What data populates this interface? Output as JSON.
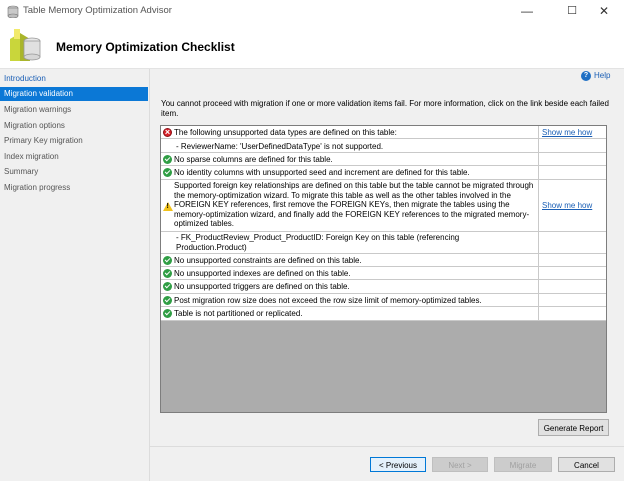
{
  "window": {
    "title": "Table Memory Optimization Advisor",
    "controls": {
      "minimize": "—",
      "maximize": "☐",
      "close": "✕"
    }
  },
  "header": {
    "title": "Memory Optimization Checklist",
    "icon": "memory-optimization-icon"
  },
  "sidebar": {
    "items": [
      {
        "label": "Introduction",
        "state": "link"
      },
      {
        "label": "Migration validation",
        "state": "active"
      },
      {
        "label": "Migration warnings",
        "state": "normal"
      },
      {
        "label": "Migration options",
        "state": "normal"
      },
      {
        "label": "Primary Key migration",
        "state": "normal"
      },
      {
        "label": "Index migration",
        "state": "normal"
      },
      {
        "label": "Summary",
        "state": "normal"
      },
      {
        "label": "Migration progress",
        "state": "normal"
      }
    ]
  },
  "main": {
    "help_label": "Help",
    "intro": "You cannot proceed with migration if one or more validation items fail. For more information, click on the link beside each failed item.",
    "checklist": [
      {
        "status": "error",
        "message": "The following unsupported data types are defined on this table:",
        "link": "Show me how"
      },
      {
        "status": "none",
        "message": "- ReviewerName: 'UserDefinedDataType' is not supported.",
        "link": ""
      },
      {
        "status": "ok",
        "message": "No sparse columns are defined for this table.",
        "link": ""
      },
      {
        "status": "ok",
        "message": "No identity columns with unsupported seed and increment are defined for this table.",
        "link": ""
      },
      {
        "status": "warning",
        "message": "Supported foreign key relationships are defined on this table but the table cannot be migrated through the memory-optimization wizard. To migrate this table as well as the other tables involved in the FOREIGN KEY references, first remove the FOREIGN KEYs, then migrate the tables using the memory-optimization wizard, and finally add the FOREIGN KEY references to the migrated memory-optimized tables.",
        "link": "Show me how"
      },
      {
        "status": "none",
        "message": "- FK_ProductReview_Product_ProductID: Foreign Key on this table (referencing Production.Product)",
        "link": ""
      },
      {
        "status": "ok",
        "message": "No unsupported constraints are defined on this table.",
        "link": ""
      },
      {
        "status": "ok",
        "message": "No unsupported indexes are defined on this table.",
        "link": ""
      },
      {
        "status": "ok",
        "message": "No unsupported triggers are defined on this table.",
        "link": ""
      },
      {
        "status": "ok",
        "message": "Post migration row size does not exceed the row size limit of memory-optimized tables.",
        "link": ""
      },
      {
        "status": "ok",
        "message": "Table is not partitioned or replicated.",
        "link": ""
      }
    ],
    "generate_report_label": "Generate Report"
  },
  "footer": {
    "previous_label": "< Previous",
    "next_label": "Next >",
    "migrate_label": "Migrate",
    "cancel_label": "Cancel"
  }
}
